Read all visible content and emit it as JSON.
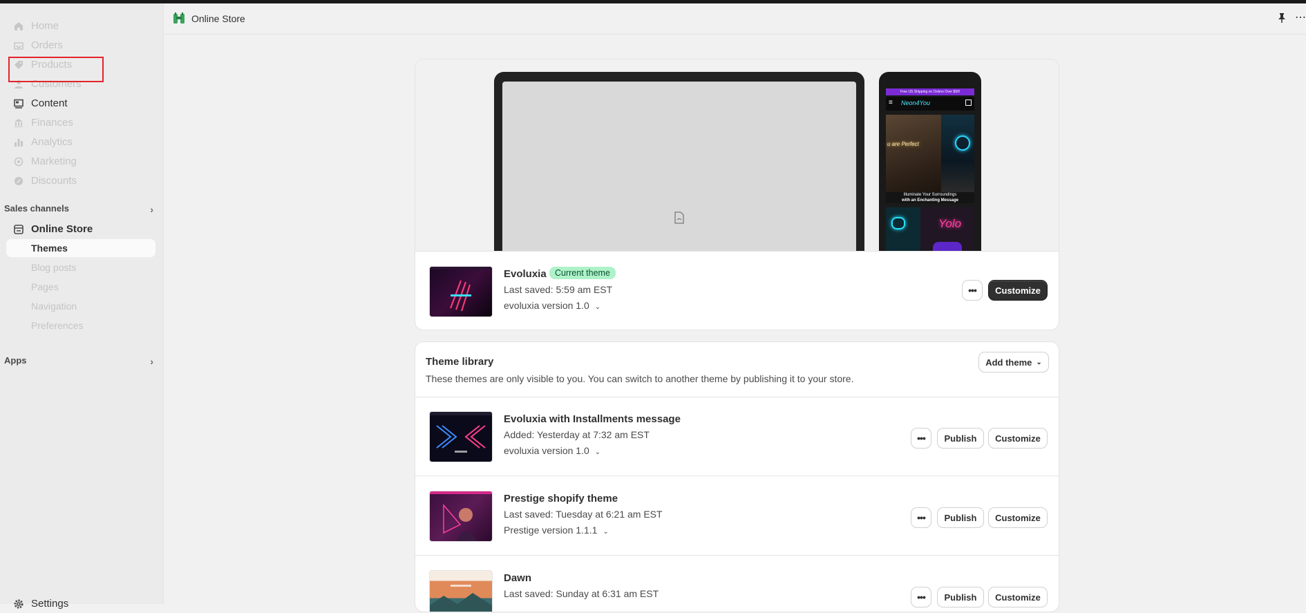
{
  "header": {
    "title": "Online Store"
  },
  "sidebar": {
    "items": [
      {
        "label": "Home",
        "icon": "home-icon"
      },
      {
        "label": "Orders",
        "icon": "inbox-icon"
      },
      {
        "label": "Products",
        "icon": "tag-icon"
      },
      {
        "label": "Customers",
        "icon": "person-icon"
      },
      {
        "label": "Content",
        "icon": "content-icon"
      },
      {
        "label": "Finances",
        "icon": "bank-icon"
      },
      {
        "label": "Analytics",
        "icon": "bar-chart-icon"
      },
      {
        "label": "Marketing",
        "icon": "target-icon"
      },
      {
        "label": "Discounts",
        "icon": "discount-icon"
      }
    ],
    "sales_channels": "Sales channels",
    "online_store": "Online Store",
    "sub_items": [
      "Themes",
      "Blog posts",
      "Pages",
      "Navigation",
      "Preferences"
    ],
    "apps": "Apps",
    "settings": "Settings"
  },
  "phone_preview": {
    "banner": "Free US Shipping on Orders Over $99!",
    "logo": "Neon4You",
    "hero_text": "u are Perfect",
    "caption_line1": "Illuminate Your Surroundings",
    "caption_line2": "with an Enchanting Message",
    "sign_text": "Yolo"
  },
  "current_theme": {
    "name": "Evoluxia",
    "badge": "Current theme",
    "saved": "Last saved: 5:59 am EST",
    "version": "evoluxia version 1.0",
    "customize": "Customize"
  },
  "library": {
    "title": "Theme library",
    "description": "These themes are only visible to you. You can switch to another theme by publishing it to your store.",
    "add_theme": "Add theme",
    "themes": [
      {
        "name": "Evoluxia with Installments message",
        "meta": "Added: Yesterday at 7:32 am EST",
        "version": "evoluxia version 1.0"
      },
      {
        "name": "Prestige shopify theme",
        "meta": "Last saved: Tuesday at 6:21 am EST",
        "version": "Prestige version 1.1.1"
      },
      {
        "name": "Dawn",
        "meta": "Last saved: Sunday at 6:31 am EST",
        "version": ""
      }
    ],
    "publish": "Publish",
    "customize": "Customize"
  },
  "colors": {
    "accent_dark": "#303030",
    "badge_bg": "#aff2c9",
    "highlight": "#e4232b"
  }
}
